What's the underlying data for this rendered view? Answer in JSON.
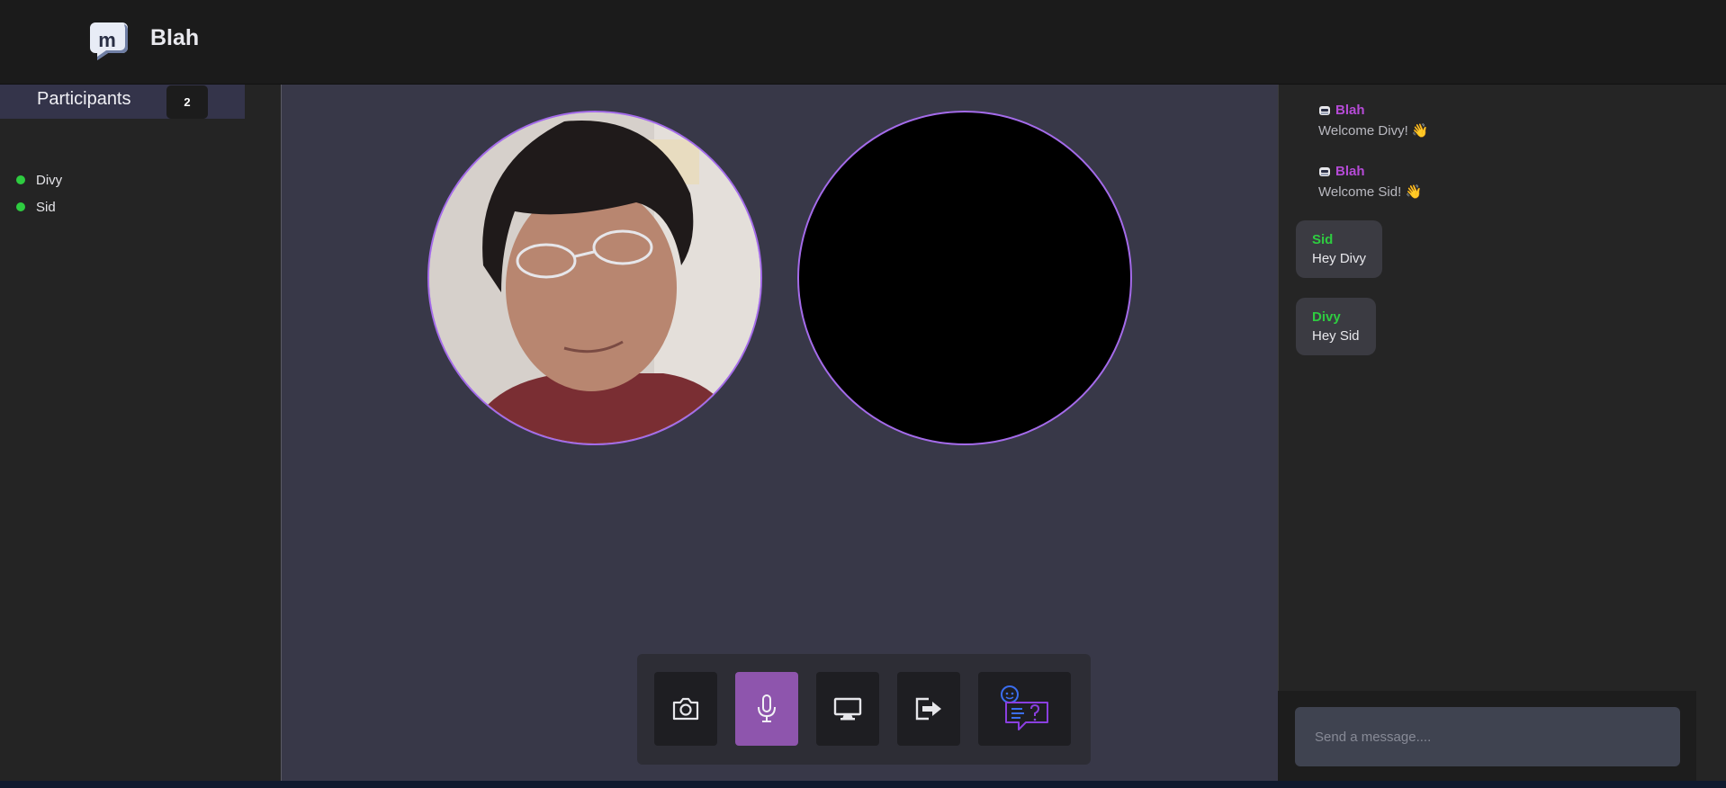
{
  "app": {
    "title": "Blah"
  },
  "participants": {
    "header": "Participants",
    "count": "2",
    "list": [
      {
        "name": "Divy",
        "status_color": "#2ecc40"
      },
      {
        "name": "Sid",
        "status_color": "#2ecc40"
      }
    ]
  },
  "videos": [
    {
      "participant": "self",
      "content": "camera-feed"
    },
    {
      "participant": "remote",
      "content": "camera-off"
    }
  ],
  "controls": [
    {
      "name": "camera-toggle",
      "icon": "camera-icon",
      "active": false
    },
    {
      "name": "mic-toggle",
      "icon": "microphone-icon",
      "active": true
    },
    {
      "name": "screen-share",
      "icon": "monitor-icon",
      "active": false
    },
    {
      "name": "leave-call",
      "icon": "exit-icon",
      "active": false
    },
    {
      "name": "chat-toggle",
      "icon": "chat-help-icon",
      "active": false
    }
  ],
  "chat": {
    "system_messages": [
      {
        "sender": "Blah",
        "text": "Welcome Divy!",
        "emoji": "👋"
      },
      {
        "sender": "Blah",
        "text": "Welcome Sid!",
        "emoji": "👋"
      }
    ],
    "messages": [
      {
        "sender": "Sid",
        "text": "Hey Divy"
      },
      {
        "sender": "Divy",
        "text": "Hey Sid"
      }
    ],
    "input_placeholder": "Send a message...."
  },
  "colors": {
    "accent": "#a46bea",
    "mic_active": "#8e55ad",
    "online": "#2ecc40",
    "bot_name": "#b54bd6"
  }
}
